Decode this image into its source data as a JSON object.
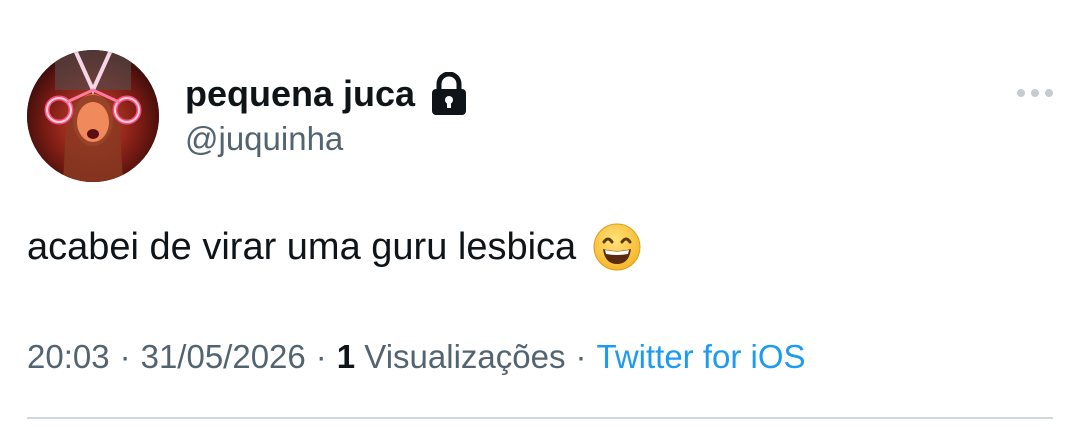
{
  "author": {
    "display_name": "pequena juca",
    "handle": "@juquinha",
    "protected": true
  },
  "tweet": {
    "text": "acabei de virar uma guru lesbica",
    "emoji": "grinning-face-with-smiling-eyes"
  },
  "meta": {
    "time": "20:03",
    "date": "31/05/2026",
    "views_count": "1",
    "views_label": "Visualizações",
    "source": "Twitter for iOS",
    "separator": "·"
  },
  "colors": {
    "text_primary": "#0f1419",
    "text_secondary": "#536471",
    "link": "#1d9bf0",
    "divider": "#cfd9de"
  }
}
